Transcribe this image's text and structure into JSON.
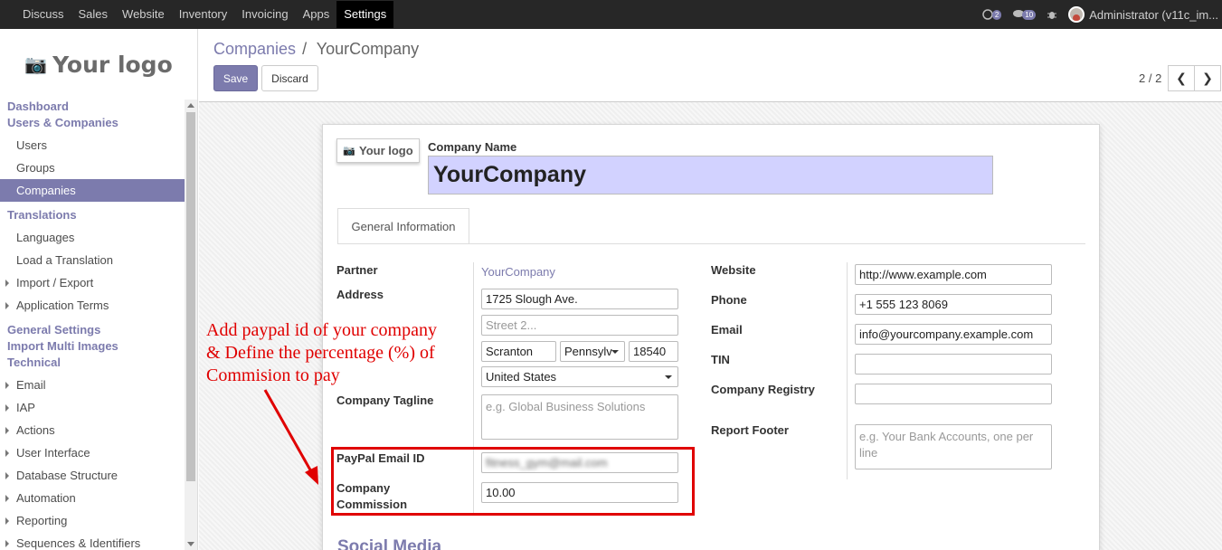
{
  "topbar": {
    "menu": [
      "Discuss",
      "Sales",
      "Website",
      "Inventory",
      "Invoicing",
      "Apps",
      "Settings"
    ],
    "active": "Settings",
    "chat_count": "2",
    "activity_count": "10",
    "user": "Administrator (v11c_im..."
  },
  "sidebar": {
    "logo": "Your logo",
    "sections": [
      {
        "head": [
          "Dashboard",
          "Users & Companies"
        ],
        "items": [
          "Users",
          "Groups",
          "Companies"
        ]
      },
      {
        "head": [
          "Translations"
        ],
        "items": [
          "Languages",
          "Load a Translation",
          "Import / Export",
          "Application Terms"
        ]
      },
      {
        "head": [
          "General Settings",
          "Import Multi Images",
          "Technical"
        ],
        "items": [
          "Email",
          "IAP",
          "Actions",
          "User Interface",
          "Database Structure",
          "Automation",
          "Reporting",
          "Sequences & Identifiers"
        ]
      }
    ]
  },
  "control": {
    "breadcrumb_parent": "Companies",
    "breadcrumb_sep": "/",
    "breadcrumb_current": "YourCompany",
    "save": "Save",
    "discard": "Discard",
    "pager": "2 / 2"
  },
  "form": {
    "logo_label": "Your logo",
    "company_name_label": "Company Name",
    "company_name": "YourCompany",
    "tab": "General Information",
    "left": {
      "partner_label": "Partner",
      "partner": "YourCompany",
      "address_label": "Address",
      "street": "1725 Slough Ave.",
      "street2_placeholder": "Street 2...",
      "city": "Scranton",
      "state": "Pennsylv",
      "zip": "18540",
      "country": "United States",
      "tagline_label": "Company Tagline",
      "tagline_placeholder": "e.g. Global Business Solutions",
      "paypal_label": "PayPal Email ID",
      "paypal_value": "fitness_gym@mail.com",
      "commission_label_1": "Company",
      "commission_label_2": "Commission",
      "commission_value": "10.00"
    },
    "right": {
      "website_label": "Website",
      "website": "http://www.example.com",
      "phone_label": "Phone",
      "phone": "+1 555 123 8069",
      "email_label": "Email",
      "email": "info@yourcompany.example.com",
      "tin_label": "TIN",
      "registry_label": "Company Registry",
      "footer_label": "Report Footer",
      "footer_placeholder": "e.g. Your Bank Accounts, one per line"
    },
    "social_heading": "Social Media"
  },
  "annotation": {
    "line1": "Add paypal id of your company",
    "line2": "& Define the percentage (%) of",
    "line3": "Commision to pay",
    "color": "#e00000"
  }
}
